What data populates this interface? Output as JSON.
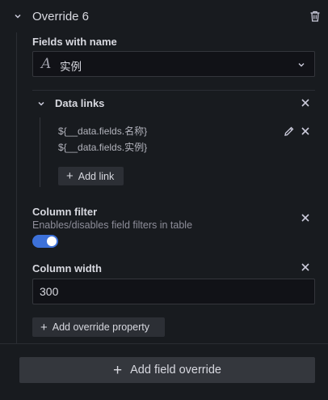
{
  "override": {
    "title": "Override 6",
    "fields_label": "Fields with name",
    "field_icon": "function-icon",
    "field_value": "实例"
  },
  "data_links": {
    "label": "Data links",
    "links": [
      "${__data.fields.名称}",
      "${__data.fields.实例}"
    ],
    "add_link_label": "Add link"
  },
  "column_filter": {
    "label": "Column filter",
    "description": "Enables/disables field filters in table",
    "enabled": true
  },
  "column_width": {
    "label": "Column width",
    "value": "300"
  },
  "add_property_label": "Add override property",
  "add_field_override_label": "Add field override",
  "colors": {
    "background": "#181b1f",
    "toggle_on": "#3d71d9",
    "button": "#2c2f35"
  }
}
